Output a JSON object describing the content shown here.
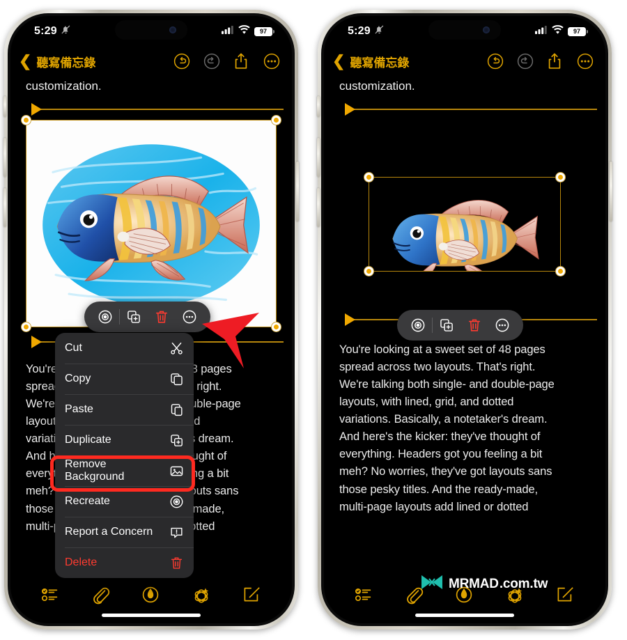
{
  "statusbar": {
    "time": "5:29",
    "bell_icon": "bell-slash-icon",
    "cellular_icon": "cellular-bars-icon",
    "wifi_icon": "wifi-icon",
    "battery_level": "97"
  },
  "navbar": {
    "back_icon": "chevron-left-icon",
    "title": "聽寫備忘錄",
    "undo_icon": "undo-icon",
    "redo_icon": "redo-icon",
    "share_icon": "share-icon",
    "more_icon": "ellipsis-circle-icon",
    "accent_color": "#e0a400",
    "disabled_color": "#6b6b6b"
  },
  "note": {
    "top_text": "customization.",
    "body_text": "You're looking at a sweet set of 48 pages\nspread across two layouts. That's right.\nWe're talking both single- and double-page\nlayouts, with lined, grid, and dotted\nvariations. Basically, a notetaker's dream.\nAnd here's the kicker: they've thought of\neverything. Headers got you feeling a bit\nmeh? No worries, they've got layouts sans\nthose pesky titles. And the ready-made,\nmulti-page layouts add lined or dotted"
  },
  "image_toolbar": {
    "recreate_icon": "recreate-target-icon",
    "duplicate_icon": "duplicate-icon",
    "delete_icon": "trash-icon",
    "more_icon": "ellipsis-circle-icon",
    "delete_color": "#ff3b30"
  },
  "context_menu": {
    "items": [
      {
        "label": "Cut",
        "icon": "scissors-icon"
      },
      {
        "label": "Copy",
        "icon": "copy-icon"
      },
      {
        "label": "Paste",
        "icon": "paste-icon"
      },
      {
        "label": "Duplicate",
        "icon": "duplicate-icon"
      },
      {
        "label": "Remove Background",
        "icon": "photo-icon"
      },
      {
        "label": "Recreate",
        "icon": "recreate-target-icon"
      },
      {
        "label": "Report a Concern",
        "icon": "report-concern-icon"
      },
      {
        "label": "Delete",
        "icon": "trash-icon"
      }
    ],
    "highlighted_item": "Remove Background",
    "highlight_color": "#ff2a20",
    "delete_color": "#ff3b30"
  },
  "annotation": {
    "arrow_icon": "red-pointer-arrow",
    "arrow_color": "#ee1c24"
  },
  "bottom_toolbar": {
    "items": [
      {
        "icon": "checklist-icon"
      },
      {
        "icon": "paperclip-icon"
      },
      {
        "icon": "markup-pen-icon"
      },
      {
        "icon": "apple-intelligence-icon"
      },
      {
        "icon": "compose-icon"
      }
    ],
    "accent_color": "#e0a400"
  },
  "watermark": {
    "logo_icon": "mrmad-butterfly-logo",
    "brand": "MRMAD",
    "suffix": ".com.tw",
    "logo_color": "#1fbfae"
  },
  "media": {
    "left_caption": "fish illustration on blue watercolor background",
    "right_caption": "fish illustration with background removed"
  }
}
